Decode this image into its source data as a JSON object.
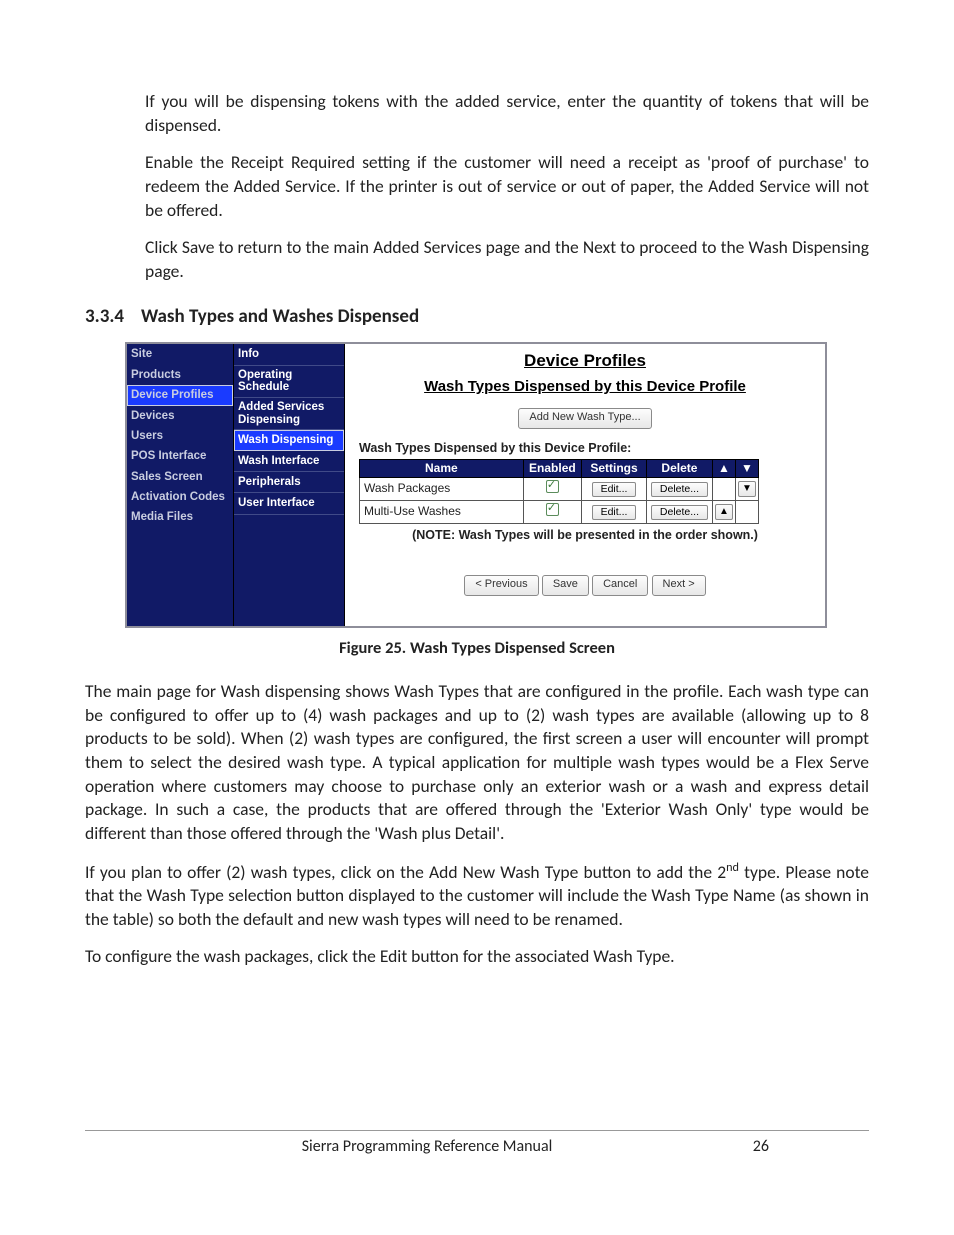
{
  "para1": "If you will be dispensing tokens with the added service, enter the quantity of tokens that will be dispensed.",
  "para2": "Enable the Receipt Required setting if the customer will need a receipt as 'proof of purchase' to redeem the Added Service. If the printer is out of service or out of paper, the Added Service will not be offered.",
  "para3": "Click Save to return to the main Added Services page and the Next to proceed to the Wash Dispensing page.",
  "section_number": "3.3.4",
  "section_title": "Wash Types and Washes Dispensed",
  "leftnav": {
    "items": [
      "Site",
      "Products",
      "Device Profiles",
      "Devices",
      "Users",
      "POS Interface",
      "Sales Screen",
      "Activation Codes",
      "Media Files"
    ],
    "active_index": 2
  },
  "secondnav": {
    "items": [
      "Info",
      "Operating Schedule",
      "Added Services Dispensing",
      "Wash Dispensing",
      "Wash Interface",
      "Peripherals",
      "User Interface"
    ],
    "active_index": 3
  },
  "pane": {
    "title": "Device Profiles",
    "subtitle": "Wash Types Dispensed by this Device Profile",
    "add_button": "Add New Wash Type...",
    "list_label": "Wash Types Dispensed by this Device Profile:",
    "columns": {
      "name": "Name",
      "enabled": "Enabled",
      "settings": "Settings",
      "delete": "Delete",
      "up": "▲",
      "down": "▼"
    },
    "rows": [
      {
        "name": "Wash Packages",
        "enabled": true,
        "edit": "Edit...",
        "delete": "Delete...",
        "arrow": "▼"
      },
      {
        "name": "Multi-Use Washes",
        "enabled": true,
        "edit": "Edit...",
        "delete": "Delete...",
        "arrow": "▲"
      }
    ],
    "note": "(NOTE: Wash Types will be presented in the order shown.)",
    "buttons": {
      "prev": "< Previous",
      "save": "Save",
      "cancel": "Cancel",
      "next": "Next >"
    }
  },
  "figure_caption": "Figure 25. Wash Types Dispensed Screen",
  "para4_a": "The main page for Wash dispensing shows Wash Types that are configured in the profile. Each wash type can be configured to offer up to (4) wash packages and up to (2) wash types are available (allowing up to 8 products to be sold). When (2) wash types are configured, the first screen a user will encounter will prompt them to select the desired wash type. A typical application for multiple wash types would be a Flex Serve operation where customers may choose to purchase only an exterior wash or a wash and express detail package. In such a case, the products that are offered through the 'Exterior Wash Only' type would be different than those offered through the 'Wash plus Detail'.",
  "para5_a": "If you plan to offer (2) wash types, click on the Add New Wash Type button to add the 2",
  "para5_sup": "nd",
  "para5_b": " type. Please note that the Wash Type selection button displayed to the customer will include the Wash Type Name (as shown in the table) so both the default and new wash types will need to be renamed.",
  "para6": "To configure the wash packages, click the Edit button for the associated Wash Type.",
  "footer_title": "Sierra Programming Reference Manual",
  "footer_page": "26"
}
